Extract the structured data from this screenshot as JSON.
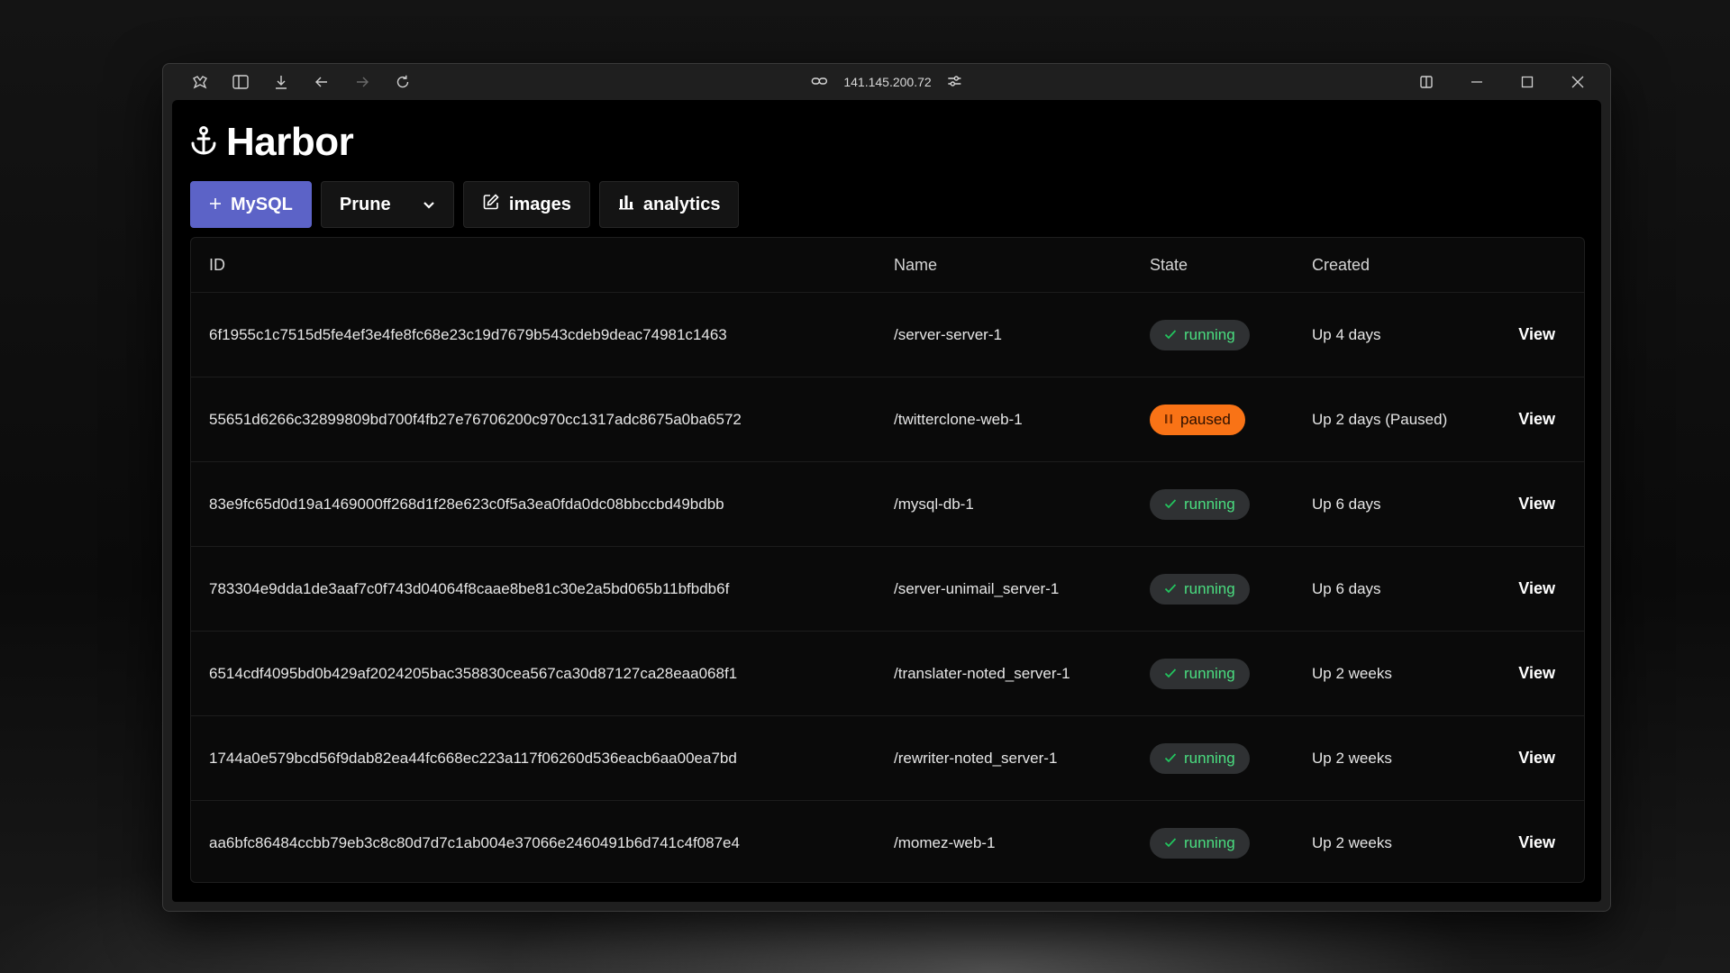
{
  "browser": {
    "address": "141.145.200.72"
  },
  "app": {
    "title": "Harbor"
  },
  "toolbar": {
    "add_label": "MySQL",
    "prune_label": "Prune",
    "images_label": "images",
    "analytics_label": "analytics"
  },
  "table": {
    "headers": {
      "id": "ID",
      "name": "Name",
      "state": "State",
      "created": "Created"
    },
    "rows": [
      {
        "id": "6f1955c1c7515d5fe4ef3e4fe8fc68e23c19d7679b543cdeb9deac74981c1463",
        "name": "/server-server-1",
        "state": "running",
        "created": "Up 4 days",
        "action": "View"
      },
      {
        "id": "55651d6266c32899809bd700f4fb27e76706200c970cc1317adc8675a0ba6572",
        "name": "/twitterclone-web-1",
        "state": "paused",
        "created": "Up 2 days (Paused)",
        "action": "View"
      },
      {
        "id": "83e9fc65d0d19a1469000ff268d1f28e623c0f5a3ea0fda0dc08bbccbd49bdbb",
        "name": "/mysql-db-1",
        "state": "running",
        "created": "Up 6 days",
        "action": "View"
      },
      {
        "id": "783304e9dda1de3aaf7c0f743d04064f8caae8be81c30e2a5bd065b11bfbdb6f",
        "name": "/server-unimail_server-1",
        "state": "running",
        "created": "Up 6 days",
        "action": "View"
      },
      {
        "id": "6514cdf4095bd0b429af2024205bac358830cea567ca30d87127ca28eaa068f1",
        "name": "/translater-noted_server-1",
        "state": "running",
        "created": "Up 2 weeks",
        "action": "View"
      },
      {
        "id": "1744a0e579bcd56f9dab82ea44fc668ec223a117f06260d536eacb6aa00ea7bd",
        "name": "/rewriter-noted_server-1",
        "state": "running",
        "created": "Up 2 weeks",
        "action": "View"
      },
      {
        "id": "aa6bfc86484ccbb79eb3c8c80d7d7c1ab004e37066e2460491b6d741c4f087e4",
        "name": "/momez-web-1",
        "state": "running",
        "created": "Up 2 weeks",
        "action": "View"
      }
    ]
  },
  "colors": {
    "primary": "#5c63c7",
    "running": "#22c55e",
    "paused": "#f97316"
  }
}
